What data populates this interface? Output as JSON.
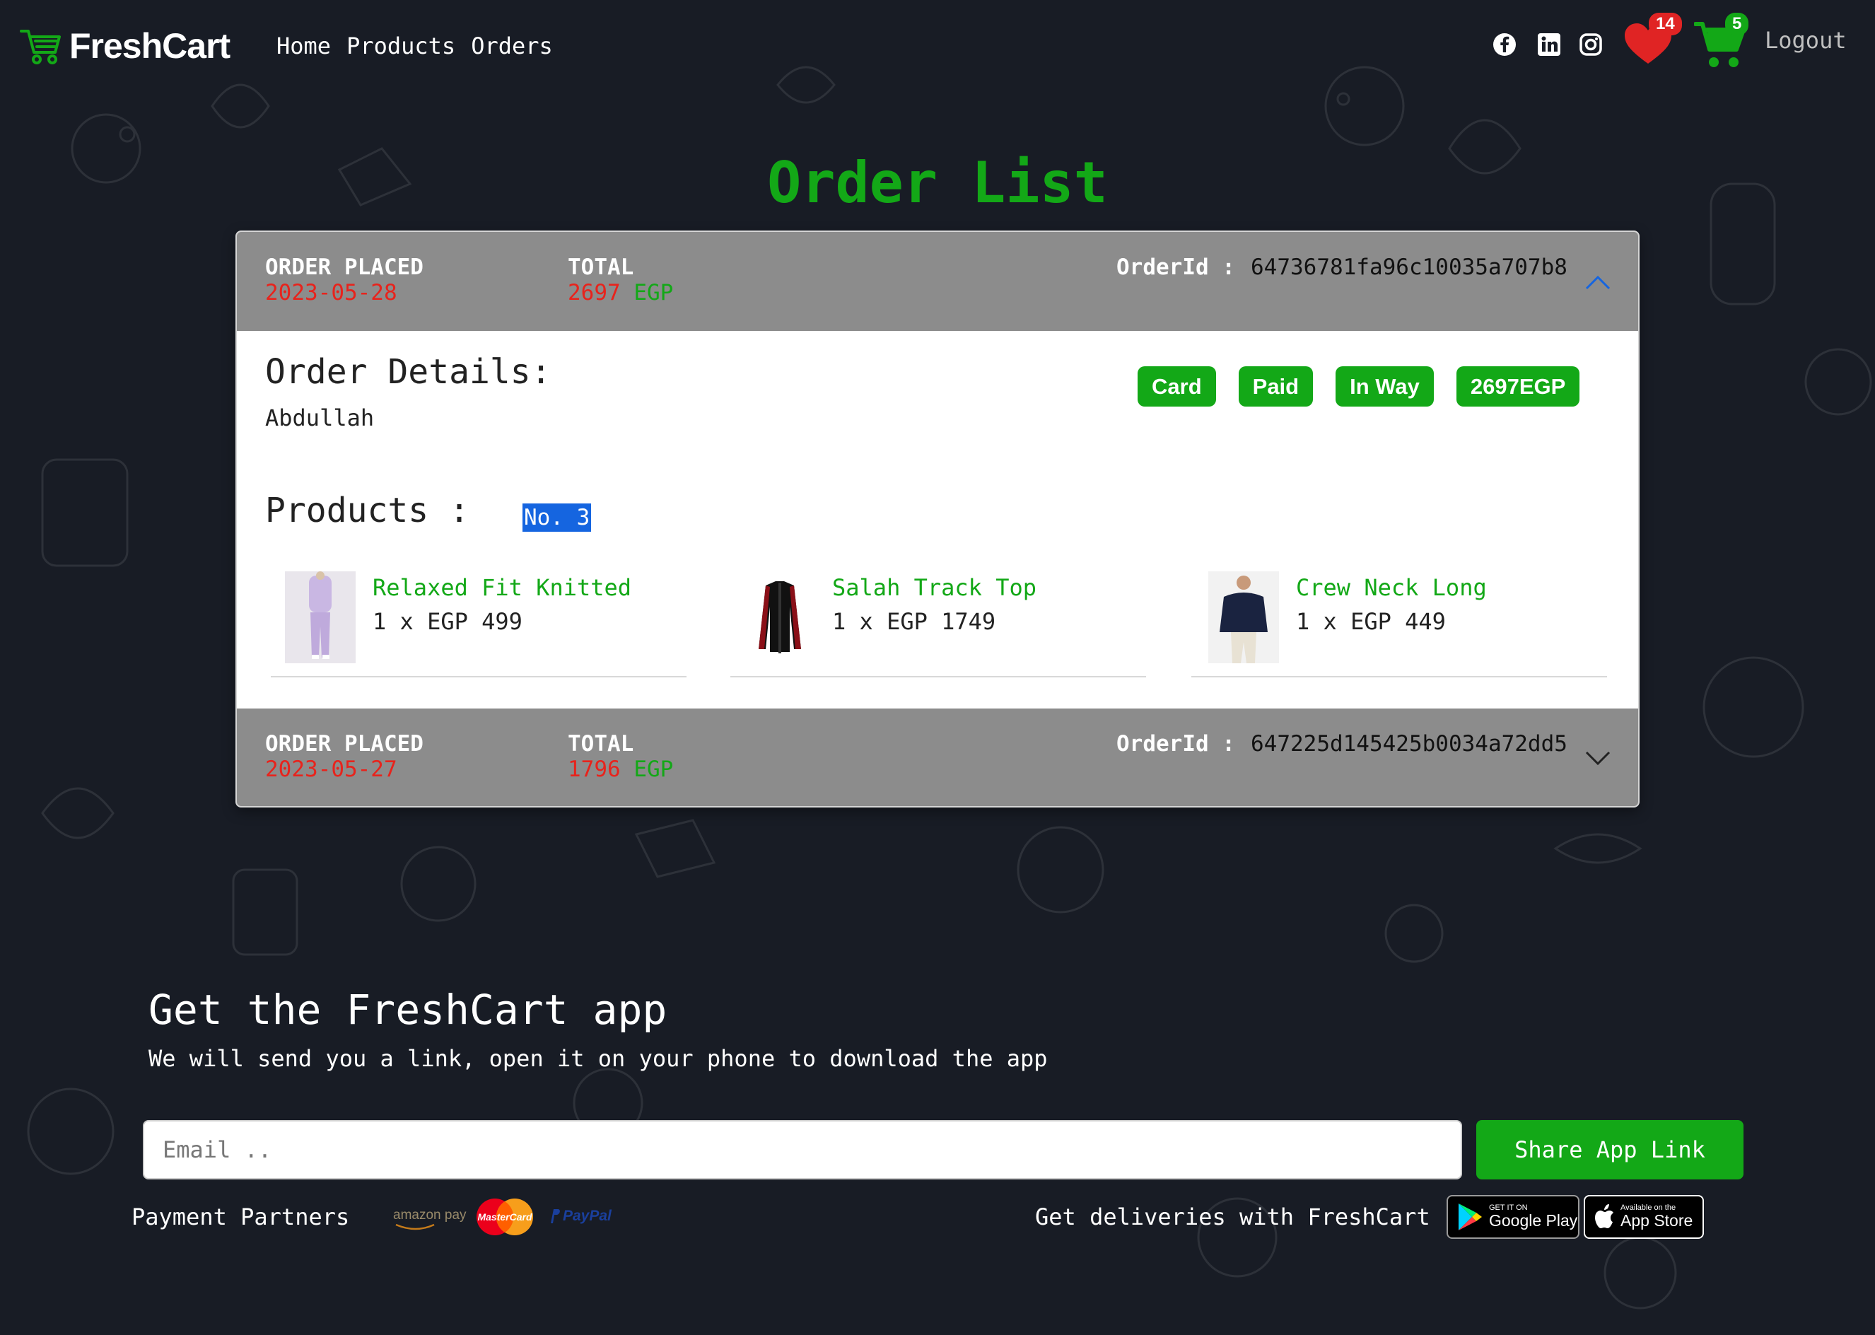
{
  "nav": {
    "brand": "FreshCart",
    "links": [
      "Home",
      "Products",
      "Orders"
    ],
    "social_icons": [
      "facebook-icon",
      "linkedin-icon",
      "instagram-icon"
    ],
    "wishlist_count": "14",
    "cart_count": "5",
    "logout": "Logout"
  },
  "page": {
    "title": "Order List"
  },
  "orders": [
    {
      "placed_label": "ORDER PLACED",
      "placed_date": "2023-05-28",
      "total_label": "TOTAL",
      "total_amount": "2697",
      "currency": "EGP",
      "orderid_label": "OrderId :",
      "order_id": "64736781fa96c10035a707b8",
      "expanded": true,
      "details_title": "Order Details:",
      "customer": "Abdullah",
      "badges": [
        "Card",
        "Paid",
        "In Way",
        "2697EGP"
      ],
      "products_label": "Products :",
      "products_count": "No. 3",
      "products": [
        {
          "name": "Relaxed Fit Knitted",
          "qty": "1 x EGP 499"
        },
        {
          "name": "Salah Track Top",
          "qty": "1 x EGP 1749"
        },
        {
          "name": "Crew Neck Long",
          "qty": "1 x EGP 449"
        }
      ]
    },
    {
      "placed_label": "ORDER PLACED",
      "placed_date": "2023-05-27",
      "total_label": "TOTAL",
      "total_amount": "1796",
      "currency": "EGP",
      "orderid_label": "OrderId :",
      "order_id": "647225d145425b0034a72dd5",
      "expanded": false
    }
  ],
  "footer": {
    "title": "Get the FreshCart app",
    "subtitle": "We will send you a link, open it on your phone to download the app",
    "email_placeholder": "Email ..",
    "email_value": "",
    "share_button": "Share App Link",
    "payment_label": "Payment Partners",
    "payment_logos": {
      "amazon": "amazon pay",
      "mastercard": "MasterCard",
      "paypal": "PayPal"
    },
    "delivery_label": "Get deliveries with FreshCart",
    "google_play": {
      "small": "GET IT ON",
      "big": "Google Play"
    },
    "app_store": {
      "small": "Available on the",
      "big": "App Store"
    }
  },
  "colors": {
    "background": "#181c25",
    "brand_green": "#13a817",
    "date_red": "#e8231c",
    "header_gray": "#8c8c8c",
    "badge_red": "#e02424",
    "selection_blue": "#1565e0"
  }
}
